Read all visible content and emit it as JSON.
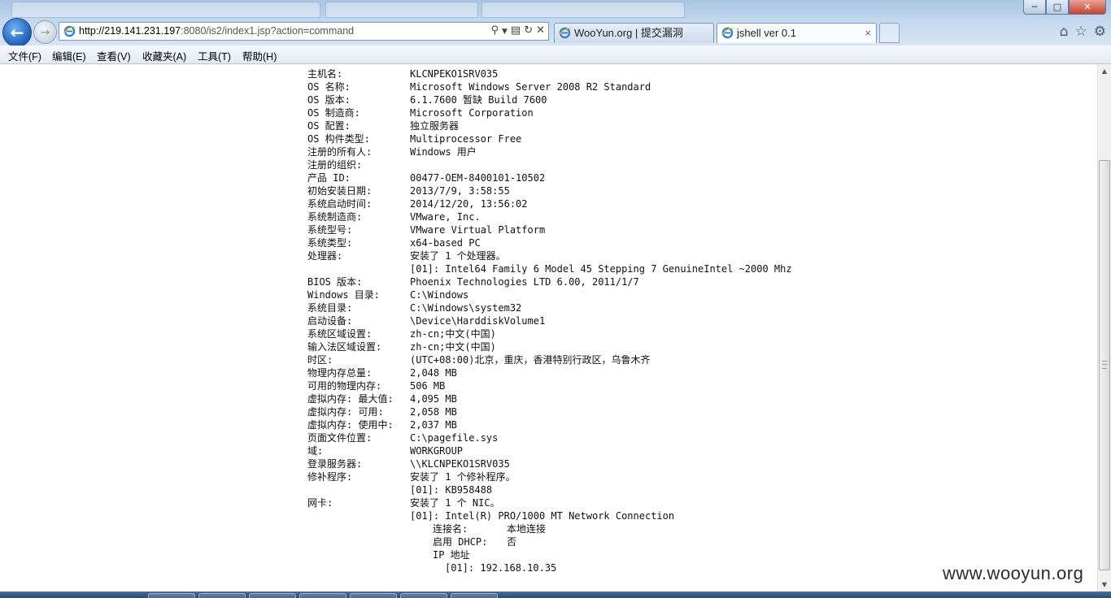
{
  "browser": {
    "address": {
      "url_host": "http://219.141.231.197",
      "url_rest": ":8080/is2/index1.jsp?action=command"
    },
    "tabs": [
      {
        "label": "WooYun.org | 提交漏洞",
        "icon": "ie-icon",
        "active": false
      },
      {
        "label": "jshell ver 0.1",
        "icon": "ie-icon",
        "active": true,
        "close": "×"
      }
    ],
    "right_icons": [
      "home-icon",
      "star-icon",
      "gear-icon"
    ],
    "colors": {
      "chrome": "#c3d8ef",
      "back_button": "#1f5fb8",
      "taskbar": "#2b4a72"
    }
  },
  "menu": [
    "文件(F)",
    "编辑(E)",
    "查看(V)",
    "收藏夹(A)",
    "工具(T)",
    "帮助(H)"
  ],
  "sysinfo": [
    {
      "key": "主机名:",
      "value": "KLCNPEKO1SRV035"
    },
    {
      "key": "OS 名称:",
      "value": "Microsoft Windows Server 2008 R2 Standard"
    },
    {
      "key": "OS 版本:",
      "value": "6.1.7600 暂缺 Build 7600"
    },
    {
      "key": "OS 制造商:",
      "value": "Microsoft Corporation"
    },
    {
      "key": "OS 配置:",
      "value": "独立服务器"
    },
    {
      "key": "OS 构件类型:",
      "value": "Multiprocessor Free"
    },
    {
      "key": "注册的所有人:",
      "value": "Windows 用户"
    },
    {
      "key": "注册的组织:",
      "value": ""
    },
    {
      "key": "产品 ID:",
      "value": "00477-OEM-8400101-10502"
    },
    {
      "key": "初始安装日期:",
      "value": "2013/7/9, 3:58:55"
    },
    {
      "key": "系统启动时间:",
      "value": "2014/12/20, 13:56:02"
    },
    {
      "key": "系统制造商:",
      "value": "VMware, Inc."
    },
    {
      "key": "系统型号:",
      "value": "VMware Virtual Platform"
    },
    {
      "key": "系统类型:",
      "value": "x64-based PC"
    },
    {
      "key": "处理器:",
      "value": "安装了 1 个处理器。"
    },
    {
      "key": "",
      "value": "[01]: Intel64 Family 6 Model 45 Stepping 7 GenuineIntel ~2000 Mhz"
    },
    {
      "key": "BIOS 版本:",
      "value": "Phoenix Technologies LTD 6.00, 2011/1/7"
    },
    {
      "key": "Windows 目录:",
      "value": "C:\\Windows"
    },
    {
      "key": "系统目录:",
      "value": "C:\\Windows\\system32"
    },
    {
      "key": "启动设备:",
      "value": "\\Device\\HarddiskVolume1"
    },
    {
      "key": "系统区域设置:",
      "value": "zh-cn;中文(中国)"
    },
    {
      "key": "输入法区域设置:",
      "value": "zh-cn;中文(中国)"
    },
    {
      "key": "时区:",
      "value": "(UTC+08:00)北京，重庆，香港特别行政区，乌鲁木齐"
    },
    {
      "key": "物理内存总量:",
      "value": "2,048 MB"
    },
    {
      "key": "可用的物理内存:",
      "value": "506 MB"
    },
    {
      "key": "虚拟内存: 最大值:",
      "value": "4,095 MB"
    },
    {
      "key": "虚拟内存: 可用:",
      "value": "2,058 MB"
    },
    {
      "key": "虚拟内存: 使用中:",
      "value": "2,037 MB"
    },
    {
      "key": "页面文件位置:",
      "value": "C:\\pagefile.sys"
    },
    {
      "key": "域:",
      "value": "WORKGROUP"
    },
    {
      "key": "登录服务器:",
      "value": "\\\\KLCNPEKO1SRV035"
    },
    {
      "key": "修补程序:",
      "value": "安装了 1 个修补程序。"
    },
    {
      "key": "",
      "value": "[01]: KB958488"
    },
    {
      "key": "网卡:",
      "value": "安装了 1 个 NIC。"
    },
    {
      "key": "",
      "value": "[01]: Intel(R) PRO/1000 MT Network Connection"
    }
  ],
  "nic_details": [
    {
      "key": "连接名:",
      "value": "本地连接"
    },
    {
      "key": "启用 DHCP:",
      "value": "否"
    },
    {
      "key": "IP 地址",
      "value": ""
    }
  ],
  "nic_ip": "[01]: 192.168.10.35",
  "watermark": "www.wooyun.org"
}
